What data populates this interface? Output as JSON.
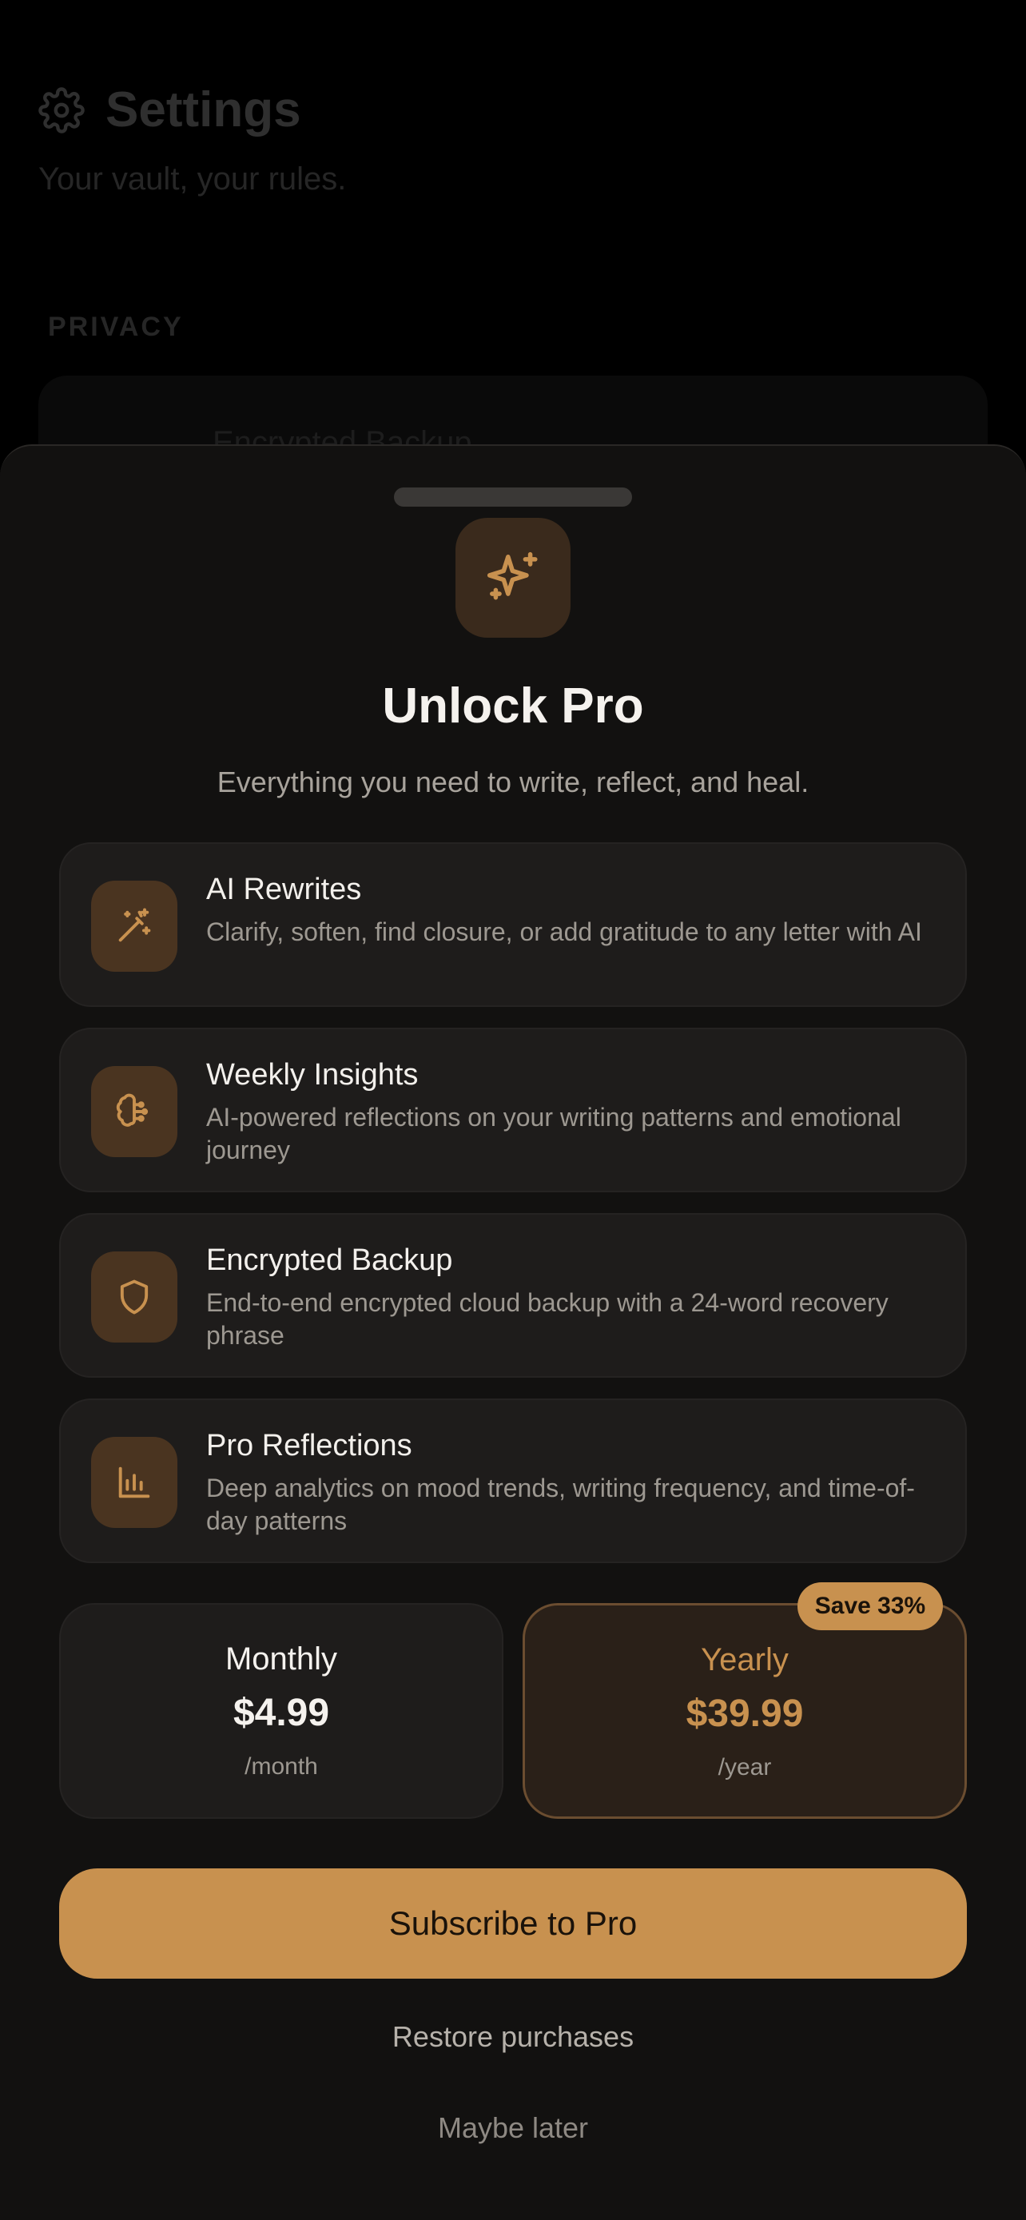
{
  "background": {
    "title": "Settings",
    "subtitle": "Your vault, your rules.",
    "section": "PRIVACY",
    "card_text": "Encrypted Backup"
  },
  "sheet": {
    "hero_icon": "sparkle-icon",
    "title": "Unlock Pro",
    "subtitle": "Everything you need to write, reflect, and heal.",
    "features": [
      {
        "icon": "magic-wand-icon",
        "title": "AI Rewrites",
        "description": "Clarify, soften, find closure, or add gratitude to any letter with AI"
      },
      {
        "icon": "brain-icon",
        "title": "Weekly Insights",
        "description": "AI-powered reflections on your writing patterns and emotional journey"
      },
      {
        "icon": "shield-icon",
        "title": "Encrypted Backup",
        "description": "End-to-end encrypted cloud backup with a 24-word recovery phrase"
      },
      {
        "icon": "bar-chart-icon",
        "title": "Pro Reflections",
        "description": "Deep analytics on mood trends, writing frequency, and time-of-day patterns"
      }
    ],
    "plans": {
      "monthly": {
        "name": "Monthly",
        "price": "$4.99",
        "period": "/month"
      },
      "yearly": {
        "name": "Yearly",
        "price": "$39.99",
        "period": "/year",
        "badge": "Save 33%",
        "selected": true
      }
    },
    "cta_label": "Subscribe to Pro",
    "restore_label": "Restore purchases",
    "later_label": "Maybe later"
  },
  "colors": {
    "accent": "#c8914f",
    "sheet_bg": "#121110",
    "card_bg": "#1e1c1b"
  }
}
